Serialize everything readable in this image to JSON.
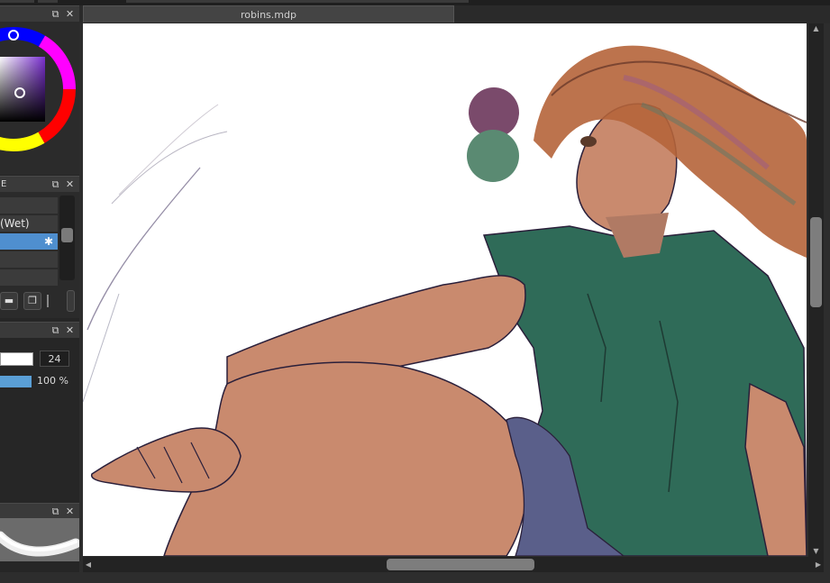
{
  "document": {
    "tab_title": "robins.mdp"
  },
  "panels": {
    "brush": {
      "header_label": "E",
      "items": [
        {
          "label": ""
        },
        {
          "label": "(Wet)"
        },
        {
          "label": ""
        },
        {
          "label": ""
        },
        {
          "label": ""
        }
      ],
      "selected_index": 2,
      "settings_glyph": "✱",
      "folder_glyph": "▬",
      "copy_glyph": "❐"
    },
    "brush_size": {
      "size_value": "24",
      "opacity_value": "100 %",
      "opacity_fraction": 1.0
    }
  },
  "icons": {
    "float_icon": "⧉",
    "close_icon": "✕",
    "scroll_up_icon": "▲",
    "scroll_down_icon": "▼",
    "scroll_left_icon": "◀",
    "scroll_right_icon": "▶"
  },
  "colors": {
    "swatch_purple": "#7a4a6b",
    "swatch_green": "#5a8a72",
    "selection_blue": "#4f8fcf",
    "shirt_green": "#2f6b58",
    "skin": "#c98a6e",
    "hair": "#b5643a",
    "shorts": "#5a5f8a"
  }
}
